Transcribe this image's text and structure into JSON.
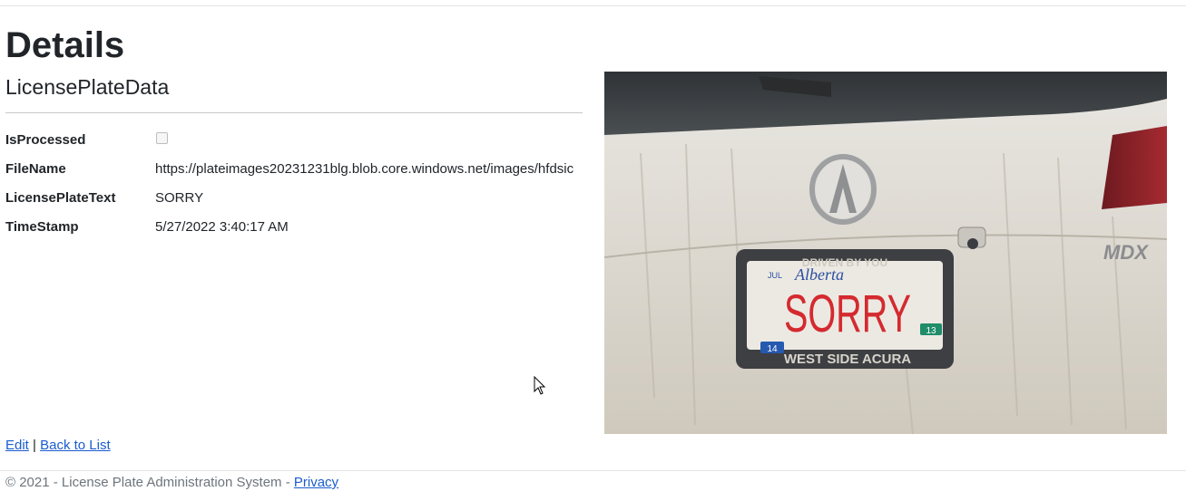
{
  "page": {
    "title": "Details",
    "subtitle": "LicensePlateData"
  },
  "details": {
    "fields": [
      {
        "label": "IsProcessed",
        "checked": false
      },
      {
        "label": "FileName",
        "value": "https://plateimages20231231blg.blob.core.windows.net/images/hfdsic"
      },
      {
        "label": "LicensePlateText",
        "value": "SORRY"
      },
      {
        "label": "TimeStamp",
        "value": "5/27/2022 3:40:17 AM"
      }
    ]
  },
  "photo": {
    "plate_text": "SORRY",
    "plate_top_text": "DRIVEN BY YOU",
    "plate_province": "Alberta",
    "plate_month": "JUL",
    "plate_frame_text": "WEST SIDE ACURA",
    "sticker_left": "14",
    "sticker_right": "13",
    "badge_text": "MDX"
  },
  "links": {
    "edit": "Edit",
    "separator": "|",
    "back": "Back to List"
  },
  "footer": {
    "copyright": "© 2021 - License Plate Administration System - ",
    "privacy": "Privacy"
  }
}
